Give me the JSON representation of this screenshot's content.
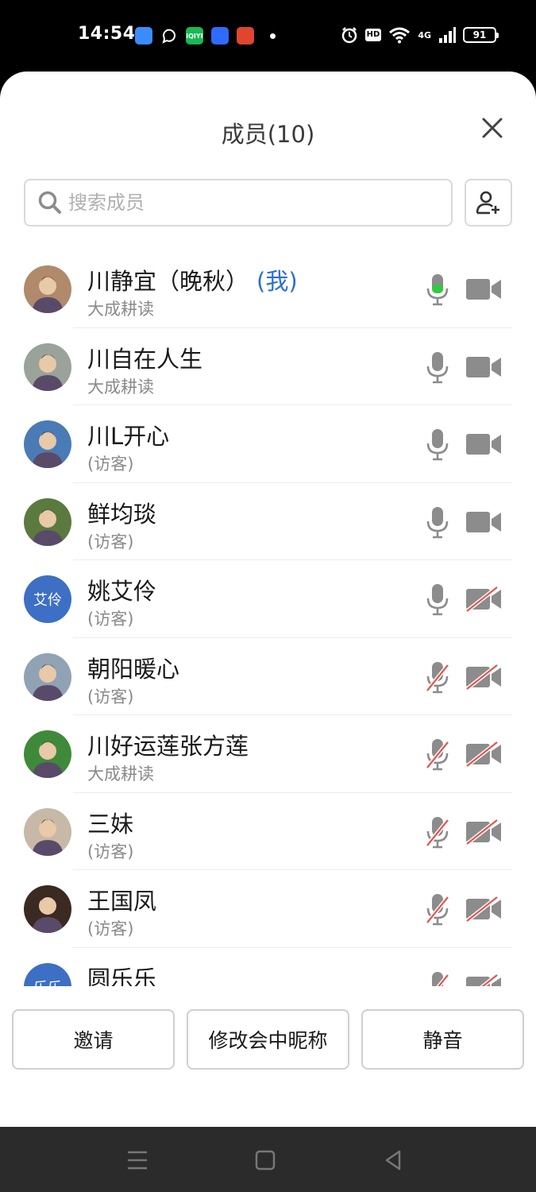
{
  "status_bar": {
    "time": "14:54",
    "apps": [
      {
        "name": "blue-app-icon",
        "color": "#3b8cff",
        "label": ""
      },
      {
        "name": "chat-bubble-icon",
        "color": "#000000",
        "label": ""
      },
      {
        "name": "iqiyi-icon",
        "color": "#19b955",
        "label": "iQIYI"
      },
      {
        "name": "blue-logo-icon",
        "color": "#2f6bff",
        "label": ""
      },
      {
        "name": "red-app-icon",
        "color": "#e0452e",
        "label": ""
      }
    ],
    "hd": "HD",
    "network": "4G",
    "battery": "91"
  },
  "sheet": {
    "title": "成员(10)",
    "search_placeholder": "搜索成员"
  },
  "members": [
    {
      "name": "川静宜（晚秋）",
      "me_tag": "(我)",
      "sub": "大成耕读",
      "avatar_text": "",
      "avatar_color": "#b08a6a",
      "mic": "on-active",
      "cam": "on"
    },
    {
      "name": "川自在人生",
      "me_tag": "",
      "sub": "大成耕读",
      "avatar_text": "",
      "avatar_color": "#9aa39a",
      "mic": "on",
      "cam": "on"
    },
    {
      "name": "川L开心",
      "me_tag": "",
      "sub": "(访客)",
      "avatar_text": "",
      "avatar_color": "#4a7bb7",
      "mic": "on",
      "cam": "on"
    },
    {
      "name": "鲜均琰",
      "me_tag": "",
      "sub": "(访客)",
      "avatar_text": "",
      "avatar_color": "#5b7a3f",
      "mic": "on",
      "cam": "on"
    },
    {
      "name": "姚艾伶",
      "me_tag": "",
      "sub": "(访客)",
      "avatar_text": "艾伶",
      "avatar_color": "#3d6fc4",
      "mic": "on",
      "cam": "off"
    },
    {
      "name": "朝阳暖心",
      "me_tag": "",
      "sub": "(访客)",
      "avatar_text": "",
      "avatar_color": "#8fa3b5",
      "mic": "off",
      "cam": "off"
    },
    {
      "name": "川好运莲张方莲",
      "me_tag": "",
      "sub": "大成耕读",
      "avatar_text": "",
      "avatar_color": "#3f8a3a",
      "mic": "off",
      "cam": "off"
    },
    {
      "name": "三妹",
      "me_tag": "",
      "sub": "(访客)",
      "avatar_text": "",
      "avatar_color": "#c7b8a8",
      "mic": "off",
      "cam": "off"
    },
    {
      "name": "王国凤",
      "me_tag": "",
      "sub": "(访客)",
      "avatar_text": "",
      "avatar_color": "#3a2a22",
      "mic": "off",
      "cam": "off"
    },
    {
      "name": "圆乐乐",
      "me_tag": "",
      "sub": "",
      "avatar_text": "乐乐",
      "avatar_color": "#3d6fc4",
      "mic": "off",
      "cam": "off"
    }
  ],
  "actions": {
    "invite": "邀请",
    "rename": "修改会中昵称",
    "mute": "静音"
  },
  "colors": {
    "icon_gray": "#8c8c8c",
    "off_slash": "#e0574f",
    "mic_active": "#2ecc40",
    "me_tag": "#2d6fd4"
  }
}
